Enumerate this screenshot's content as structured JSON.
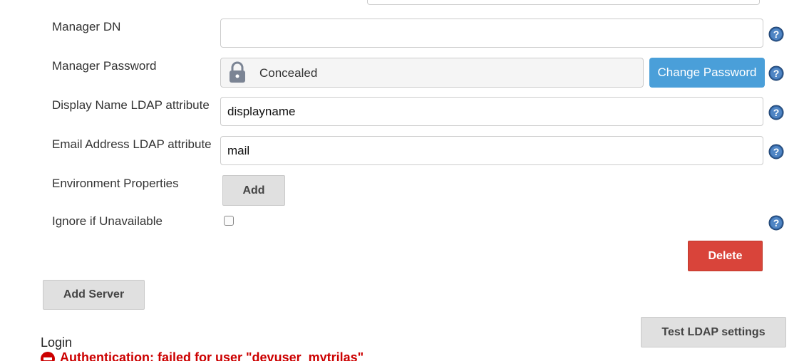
{
  "fields": {
    "manager_dn": {
      "label": "Manager DN",
      "value": ""
    },
    "manager_password": {
      "label": "Manager Password",
      "concealed_text": "Concealed",
      "change_button": "Change Password"
    },
    "display_name_attr": {
      "label": "Display Name LDAP attribute",
      "value": "displayname"
    },
    "email_attr": {
      "label": "Email Address LDAP attribute",
      "value": "mail"
    },
    "environment_properties": {
      "label": "Environment Properties",
      "add_button": "Add"
    },
    "ignore_if_unavailable": {
      "label": "Ignore if Unavailable",
      "checked": false
    }
  },
  "buttons": {
    "delete": "Delete",
    "add_server": "Add Server",
    "test_ldap": "Test LDAP settings"
  },
  "login": {
    "label": "Login",
    "error_text": "Authentication: failed for user \"devuser_mytrilas\""
  },
  "colors": {
    "primary_button": "#4a9fd9",
    "danger_button": "#d9443a",
    "error_text": "#cc0000",
    "help_icon": "#2f5f9a"
  },
  "icons": {
    "help": "help-icon",
    "lock": "lock-icon",
    "error": "error-icon"
  }
}
